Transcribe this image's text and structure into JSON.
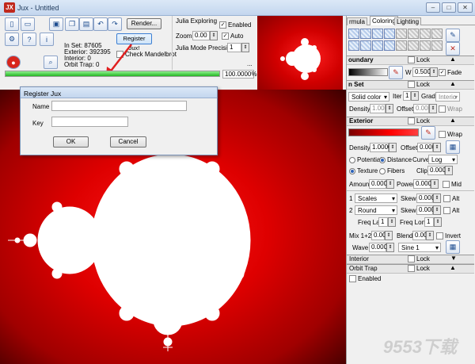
{
  "window": {
    "title": "Jux - Untitled",
    "app_icon": "JX"
  },
  "toolbar": {
    "render_label": "Render...",
    "register_label": "Register Jux!",
    "stats": {
      "in_set": "In Set: 87605",
      "exterior": "Exterior: 392395",
      "interior": "Interior: 0",
      "orbit_trap": "Orbit Trap: 0"
    },
    "check_mandelbrot_label": "Check Mandelbrot",
    "progress_percent": 100,
    "progress_label": "100.0000%"
  },
  "julia": {
    "exploring_label": "Julia Exploring",
    "enabled_label": "Enabled",
    "zoom_label": "Zoom",
    "zoom_value": "0.00",
    "auto_label": "Auto",
    "precision_label": "Julia Mode Precision",
    "precision_value": "1",
    "dots": "..."
  },
  "dialog": {
    "title": "Register Jux",
    "name_label": "Name",
    "key_label": "Key",
    "name_value": "",
    "key_value": "",
    "ok_label": "OK",
    "cancel_label": "Cancel"
  },
  "panel": {
    "tabs": [
      "rmula",
      "Coloring",
      "Lighting"
    ],
    "boundary": {
      "title": "oundary",
      "lock_label": "Lock",
      "w_label": "W",
      "w_value": "0.500",
      "fade_label": "Fade"
    },
    "inset": {
      "title": "n Set",
      "lock_label": "Lock",
      "mode": "Solid color",
      "iter_label": "Iter",
      "iter_value": "1",
      "grad_label": "Grad",
      "grad_value": "Interio",
      "density_label": "Density",
      "density_value": "1.000",
      "offset_label": "Offset",
      "offset_value": "0.000",
      "wrap_label": "Wrap"
    },
    "exterior": {
      "title": "Exterior",
      "lock_label": "Lock",
      "wrap_label": "Wrap",
      "density_label": "Density",
      "density_value": "1.0000",
      "offset_label": "Offset",
      "offset_value": "0.000",
      "potential_label": "Potential",
      "distance_label": "Distance",
      "curve_label": "Curve",
      "curve_value": "Log",
      "texture_label": "Texture",
      "fibers_label": "Fibers",
      "clip_label": "Clip",
      "clip_value": "0.000",
      "amount_label": "Amount",
      "amount_value": "0.000",
      "power_label": "Power",
      "power_value": "0.000",
      "mid_label": "Mid",
      "row1_num": "1",
      "row1_select": "Scales",
      "row1_skew_label": "Skew",
      "row1_skew": "0.000",
      "row1_alt": "Alt",
      "row2_num": "2",
      "row2_select": "Round",
      "row2_skew_label": "Skew",
      "row2_skew": "0.000",
      "row2_alt": "Alt",
      "freqlat_label": "Freq Lat",
      "freqlat_value": "1",
      "freqlong_label": "Freq Long",
      "freqlong_value": "1",
      "mix_label": "Mix 1+2",
      "mix_value": "0.00",
      "blend_label": "Blend",
      "blend_value": "0.00",
      "invert_label": "Invert",
      "wave_label": "Wave",
      "wave_value": "0.000",
      "wave_select": "Sine 1"
    },
    "interior": {
      "title": "Interior",
      "lock_label": "Lock"
    },
    "orbit": {
      "title": "Orbit Trap",
      "lock_label": "Lock",
      "enabled_label": "Enabled"
    }
  },
  "watermark": "9553下载",
  "colors": {
    "fractal_red": "#cc0000",
    "accent_blue": "#1f5fbf",
    "progress_green": "#2fc52f"
  }
}
